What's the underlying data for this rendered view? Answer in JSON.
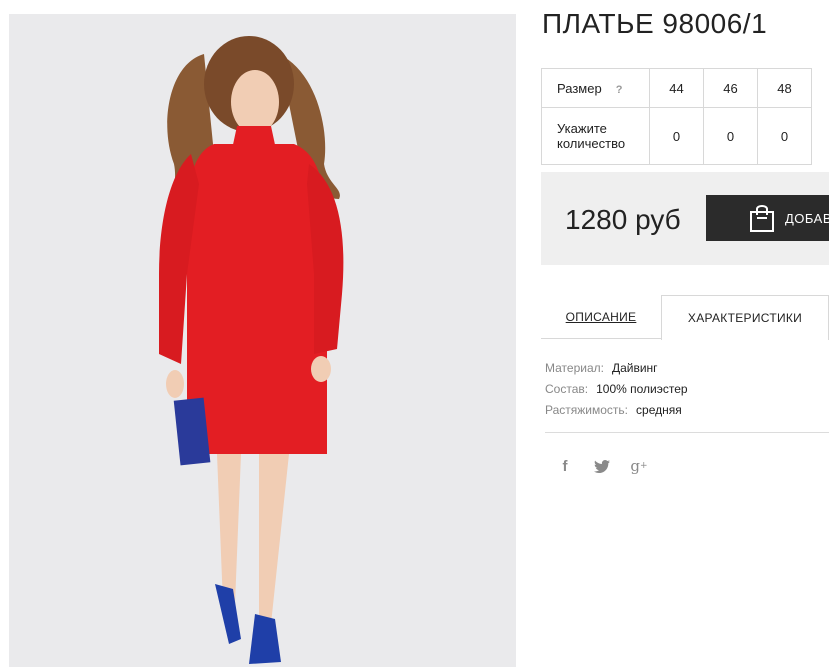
{
  "product": {
    "title": "ПЛАТЬЕ 98006/1",
    "image_alt": "product-photo-red-dress"
  },
  "size_table": {
    "size_label": "Размер",
    "help_mark": "?",
    "sizes": [
      "44",
      "46",
      "48"
    ],
    "qty_label": "Укажите количество",
    "quantities": [
      "0",
      "0",
      "0"
    ]
  },
  "purchase": {
    "price": "1280 руб",
    "add_button_label": "ДОБАВИТЬ В КОРЗИНУ"
  },
  "tabs": {
    "description": "ОПИСАНИЕ",
    "specs": "ХАРАКТЕРИСТИКИ"
  },
  "specs": [
    {
      "key": "Материал:",
      "value": "Дайвинг"
    },
    {
      "key": "Состав:",
      "value": "100% полиэстер"
    },
    {
      "key": "Растяжимость:",
      "value": "средняя"
    }
  ],
  "social": {
    "facebook": "f",
    "google_plus": "g",
    "google_plus_sup": "+"
  },
  "colors": {
    "button_bg": "#2b2b2b",
    "price_box_bg": "#efefef",
    "dress_red": "#e31e23"
  }
}
